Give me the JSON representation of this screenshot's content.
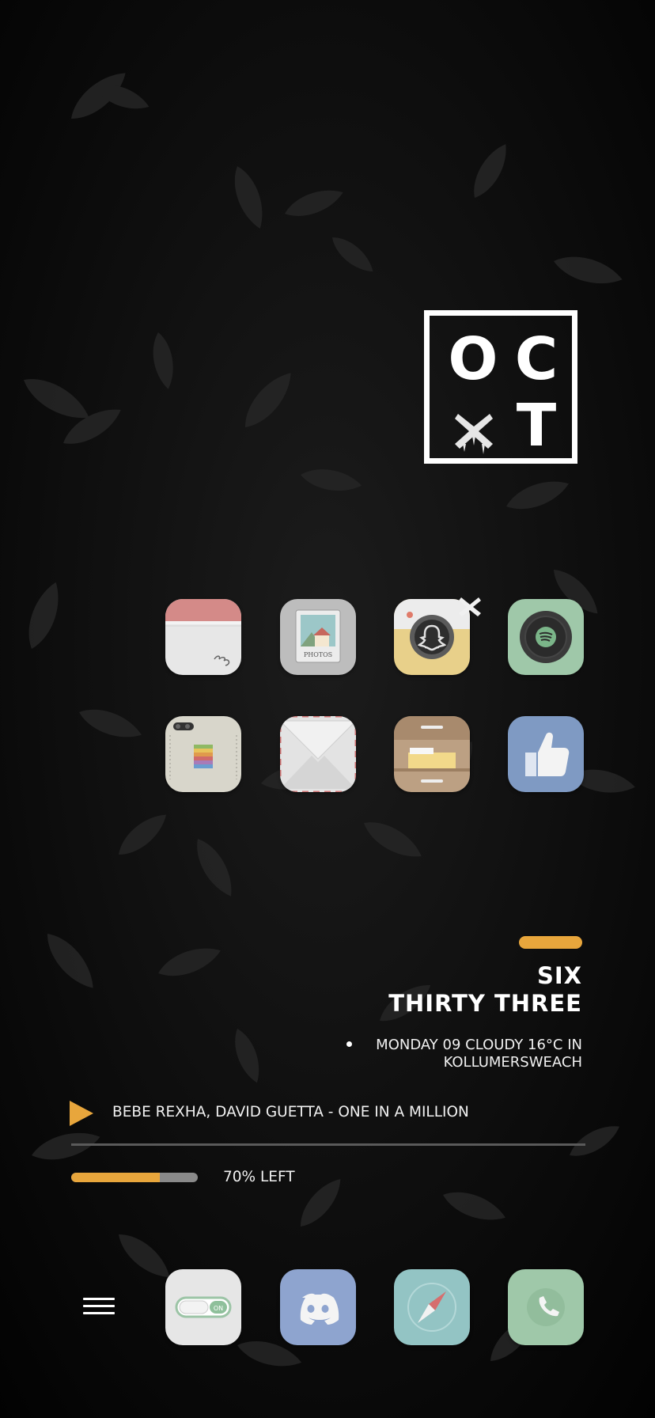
{
  "month_widget": {
    "letters": [
      "O",
      "C",
      "T"
    ],
    "icon": "x-mark-icon"
  },
  "apps": [
    {
      "name": "Calendar",
      "icon": "calendar-icon"
    },
    {
      "name": "Photos",
      "icon": "photos-icon",
      "label_text": "PHOTOS"
    },
    {
      "name": "Snapchat",
      "icon": "snapchat-icon",
      "badge": "close-badge-icon"
    },
    {
      "name": "Spotify",
      "icon": "spotify-icon"
    },
    {
      "name": "Apple",
      "icon": "apple-device-icon"
    },
    {
      "name": "Mail",
      "icon": "mail-envelope-icon"
    },
    {
      "name": "Files",
      "icon": "file-cabinet-icon"
    },
    {
      "name": "Facebook",
      "icon": "thumbs-up-icon"
    }
  ],
  "dock": {
    "menu_icon": "hamburger-menu-icon",
    "apps": [
      {
        "name": "Settings",
        "icon": "toggle-switch-icon",
        "toggle_text": "ON"
      },
      {
        "name": "Discord",
        "icon": "discord-icon"
      },
      {
        "name": "Safari",
        "icon": "compass-icon"
      },
      {
        "name": "Phone",
        "icon": "phone-icon"
      }
    ]
  },
  "time_widget": {
    "hour": "SIX",
    "minutes": "THIRTY THREE",
    "weather_line1": "MONDAY 09 CLOUDY 16°C IN",
    "weather_line2": "KOLLUMERSWEACH"
  },
  "music": {
    "play_icon": "play-icon",
    "track": "BEBE REXHA, DAVID GUETTA - ONE IN A MILLION"
  },
  "battery": {
    "level_percent": 70,
    "label": "70% LEFT"
  },
  "colors": {
    "accent": "#e8a63c",
    "background": "#040404"
  }
}
